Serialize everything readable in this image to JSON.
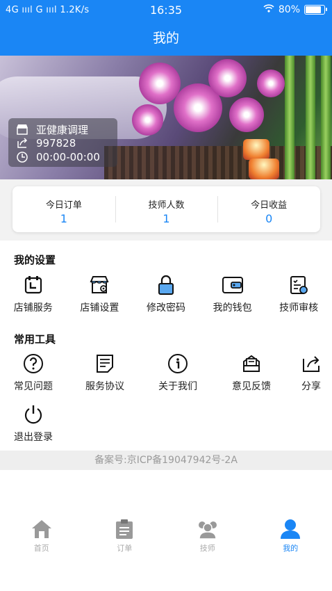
{
  "status_bar": {
    "network": "4G ıııl G ıııl 1.2K/s",
    "time": "16:35",
    "battery": "80%",
    "battery_level": 0.8
  },
  "header": {
    "title": "我的"
  },
  "store": {
    "name": "亚健康调理",
    "id": "997828",
    "hours": "00:00-00:00"
  },
  "stats": [
    {
      "label": "今日订单",
      "value": "1"
    },
    {
      "label": "技师人数",
      "value": "1"
    },
    {
      "label": "今日收益",
      "value": "0"
    }
  ],
  "settings": {
    "title": "我的设置",
    "items": [
      {
        "label": "店铺服务",
        "icon": "store-service-icon"
      },
      {
        "label": "店铺设置",
        "icon": "store-settings-icon"
      },
      {
        "label": "修改密码",
        "icon": "lock-icon"
      },
      {
        "label": "我的钱包",
        "icon": "wallet-icon"
      },
      {
        "label": "技师审核",
        "icon": "audit-icon"
      }
    ]
  },
  "tools": {
    "title": "常用工具",
    "items": [
      {
        "label": "常见问题",
        "icon": "question-icon"
      },
      {
        "label": "服务协议",
        "icon": "document-icon"
      },
      {
        "label": "关于我们",
        "icon": "info-icon"
      },
      {
        "label": "意见反馈",
        "icon": "feedback-icon"
      },
      {
        "label": "分享",
        "icon": "share-icon"
      }
    ],
    "logout_label": "退出登录"
  },
  "footer": {
    "icp": "备案号:京ICP备19047942号-2A"
  },
  "tabbar": [
    {
      "label": "首页",
      "icon": "home-icon"
    },
    {
      "label": "订单",
      "icon": "clipboard-icon"
    },
    {
      "label": "技师",
      "icon": "group-icon"
    },
    {
      "label": "我的",
      "icon": "user-icon"
    }
  ],
  "colors": {
    "accent": "#1a86f5",
    "inactive": "#aaaaaa"
  }
}
